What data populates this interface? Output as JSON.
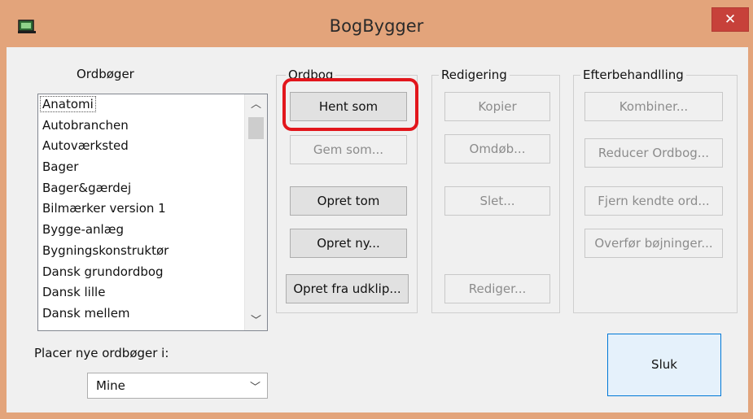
{
  "window": {
    "title": "BogBygger",
    "close_label": "✕"
  },
  "dictionaries": {
    "label": "Ordbøger",
    "items": [
      "Anatomi",
      "Autobranchen",
      "Autoværksted",
      "Bager",
      "Bager&gærdej",
      "Bilmærker version 1",
      "Bygge-anlæg",
      "Bygningskonstruktør",
      "Dansk grundordbog",
      "Dansk lille",
      "Dansk mellem"
    ],
    "selected": "Anatomi"
  },
  "placement": {
    "label": "Placer nye ordbøger i:",
    "value": "Mine"
  },
  "group_ordbog": {
    "label": "Ordbog",
    "hent_som": "Hent som",
    "gem_som": "Gem som...",
    "opret_tom": "Opret tom",
    "opret_ny": "Opret ny...",
    "opret_fra_udklip": "Opret fra udklip..."
  },
  "group_redigering": {
    "label": "Redigering",
    "kopier": "Kopier",
    "omdob": "Omdøb...",
    "slet": "Slet...",
    "rediger": "Rediger..."
  },
  "group_efterbehandling": {
    "label": "Efterbehandlling",
    "kombiner": "Kombiner...",
    "reducer": "Reducer Ordbog...",
    "fjern": "Fjern kendte ord...",
    "overfor": "Overfør bøjninger..."
  },
  "sluk": "Sluk",
  "colors": {
    "titlebar": "#e3a47b",
    "close": "#c7413a",
    "highlight": "#e2161c",
    "focus_border": "#0078d7"
  }
}
